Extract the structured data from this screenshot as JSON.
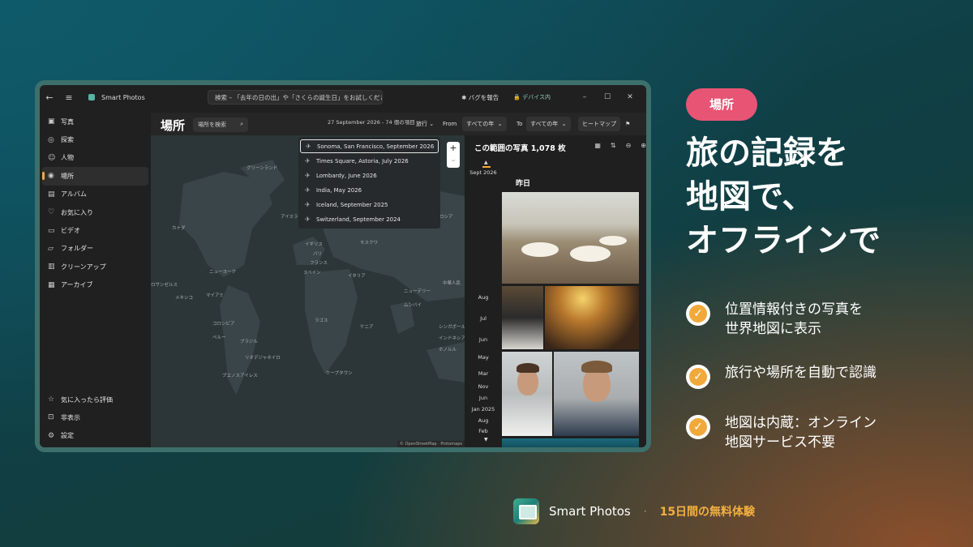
{
  "window": {
    "app_name": "Smart Photos",
    "search_placeholder": "検索 – 「去年の日の出」や「さくらの誕生日」をお試しください",
    "bug_report": "バグを報告",
    "on_device": "デバイス内"
  },
  "sidebar": {
    "items": [
      {
        "label": "写真",
        "icon": "photo-icon"
      },
      {
        "label": "探索",
        "icon": "explore-icon"
      },
      {
        "label": "人物",
        "icon": "people-icon"
      },
      {
        "label": "場所",
        "icon": "places-icon",
        "active": true
      },
      {
        "label": "アルバム",
        "icon": "album-icon"
      },
      {
        "label": "お気に入り",
        "icon": "heart-icon"
      },
      {
        "label": "ビデオ",
        "icon": "video-icon"
      },
      {
        "label": "フォルダー",
        "icon": "folder-icon"
      },
      {
        "label": "クリーンアップ",
        "icon": "trash-icon"
      },
      {
        "label": "アーカイブ",
        "icon": "archive-icon"
      }
    ],
    "bottom": [
      {
        "label": "気に入ったら評価",
        "icon": "star-icon"
      },
      {
        "label": "非表示",
        "icon": "lock-icon"
      },
      {
        "label": "設定",
        "icon": "gear-icon"
      }
    ]
  },
  "toolbar": {
    "title": "場所",
    "location_search_placeholder": "場所を検索",
    "range_info": "27 September 2026 - 74 個の項目",
    "trip_filter": "旅行",
    "from_label": "From",
    "from_value": "すべての年",
    "to_label": "To",
    "to_value": "すべての年",
    "heatmap": "ヒートマップ"
  },
  "trips": [
    "Sonoma, San Francisco, September 2026",
    "Times Square, Astoria, July 2026",
    "Lombardy, June 2026",
    "India, May 2026",
    "Iceland, September 2025",
    "Switzerland, September 2024"
  ],
  "map": {
    "labels": [
      "グリーンランド",
      "カナダ",
      "アイスランド",
      "ロシア",
      "イギリス",
      "モスクワ",
      "パリ",
      "フランス",
      "ニューヨーク",
      "スペイン",
      "ロサンゼルス",
      "イタリア",
      "中華人民",
      "メキシコ",
      "マイアミ",
      "ニューデリー",
      "ムンバイ",
      "コロンビア",
      "ラゴス",
      "ケニア",
      "シンガポール",
      "ペルー",
      "ブラジル",
      "リオデジャネイロ",
      "ブエノスアイレス",
      "ケープタウン",
      "インドネシア",
      "ホノルル"
    ],
    "attribution": "© OpenStreetMap · Protomaps"
  },
  "photo_panel": {
    "title": "この範囲の写真 1,078 枚",
    "day_header": "昨日",
    "timeline": [
      "Sept 2026",
      "Aug",
      "Jul",
      "Jun",
      "May",
      "Mar",
      "Nov",
      "Jun",
      "Jan 2025",
      "Aug",
      "Feb"
    ]
  },
  "promo": {
    "tag": "場所",
    "headline_lines": [
      "旅の記録を",
      "地図で、",
      "オフラインで"
    ],
    "features": [
      "位置情報付きの写真を\n世界地図に表示",
      "旅行や場所を自動で認識",
      "地図は内蔵：オンライン\n地図サービス不要"
    ],
    "footer_name": "Smart Photos",
    "footer_dot": "·",
    "footer_cta": "15日間の無料体験"
  },
  "colors": {
    "tag_pink": "#e85474",
    "check_orange": "#f2a93b",
    "cta_gold": "#f2b040",
    "active_accent": "#f0a93c"
  }
}
